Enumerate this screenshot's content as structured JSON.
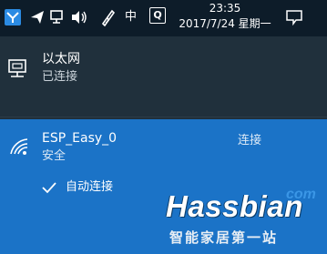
{
  "taskbar": {
    "icons": [
      "flag-icon",
      "send-icon",
      "network-icon",
      "volume-icon",
      "pen-icon"
    ],
    "ime_label": "中",
    "q_label": "Q",
    "clock_time": "23:35",
    "clock_date": "2017/7/24 星期一",
    "notification_icon": "notification-icon"
  },
  "ethernet": {
    "icon": "ethernet-icon",
    "name": "以太网",
    "status": "已连接"
  },
  "wifi": {
    "icon": "wifi-icon",
    "name": "ESP_Easy_0",
    "security": "安全",
    "auto_connect_label": "自动连接",
    "auto_connect_checked": true,
    "connect_label": "连接"
  },
  "watermark": {
    "brand": "Hassbian",
    "tld": "com",
    "tagline": "智能家居第一站"
  },
  "colors": {
    "taskbar": "#0d1c29",
    "flyout": "#20303c",
    "selected": "#1b73c7",
    "accent": "#3a96e6"
  }
}
